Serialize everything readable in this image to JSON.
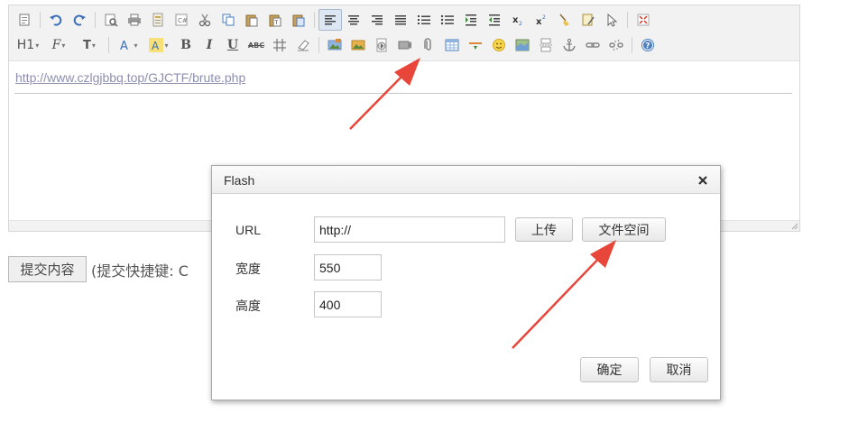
{
  "editor": {
    "toolbar": {
      "heading_label": "H1",
      "font_family_label": "F",
      "font_size_label": "T",
      "bold_label": "B",
      "italic_label": "I",
      "underline_label": "U",
      "strike_label": "ABC",
      "accent_color": "#3b6fb6",
      "arrow_color": "#e8463a"
    },
    "content": {
      "link_text": "http://www.czlgjbbq.top/GJCTF/brute.php"
    }
  },
  "submit": {
    "button_label": "提交内容",
    "hint_text": "(提交快捷键: C"
  },
  "dialog": {
    "title": "Flash",
    "url_label": "URL",
    "url_value": "http://",
    "upload_button": "上传",
    "file_space_button": "文件空间",
    "width_label": "宽度",
    "width_value": "550",
    "height_label": "高度",
    "height_value": "400",
    "ok_button": "确定",
    "cancel_button": "取消"
  }
}
